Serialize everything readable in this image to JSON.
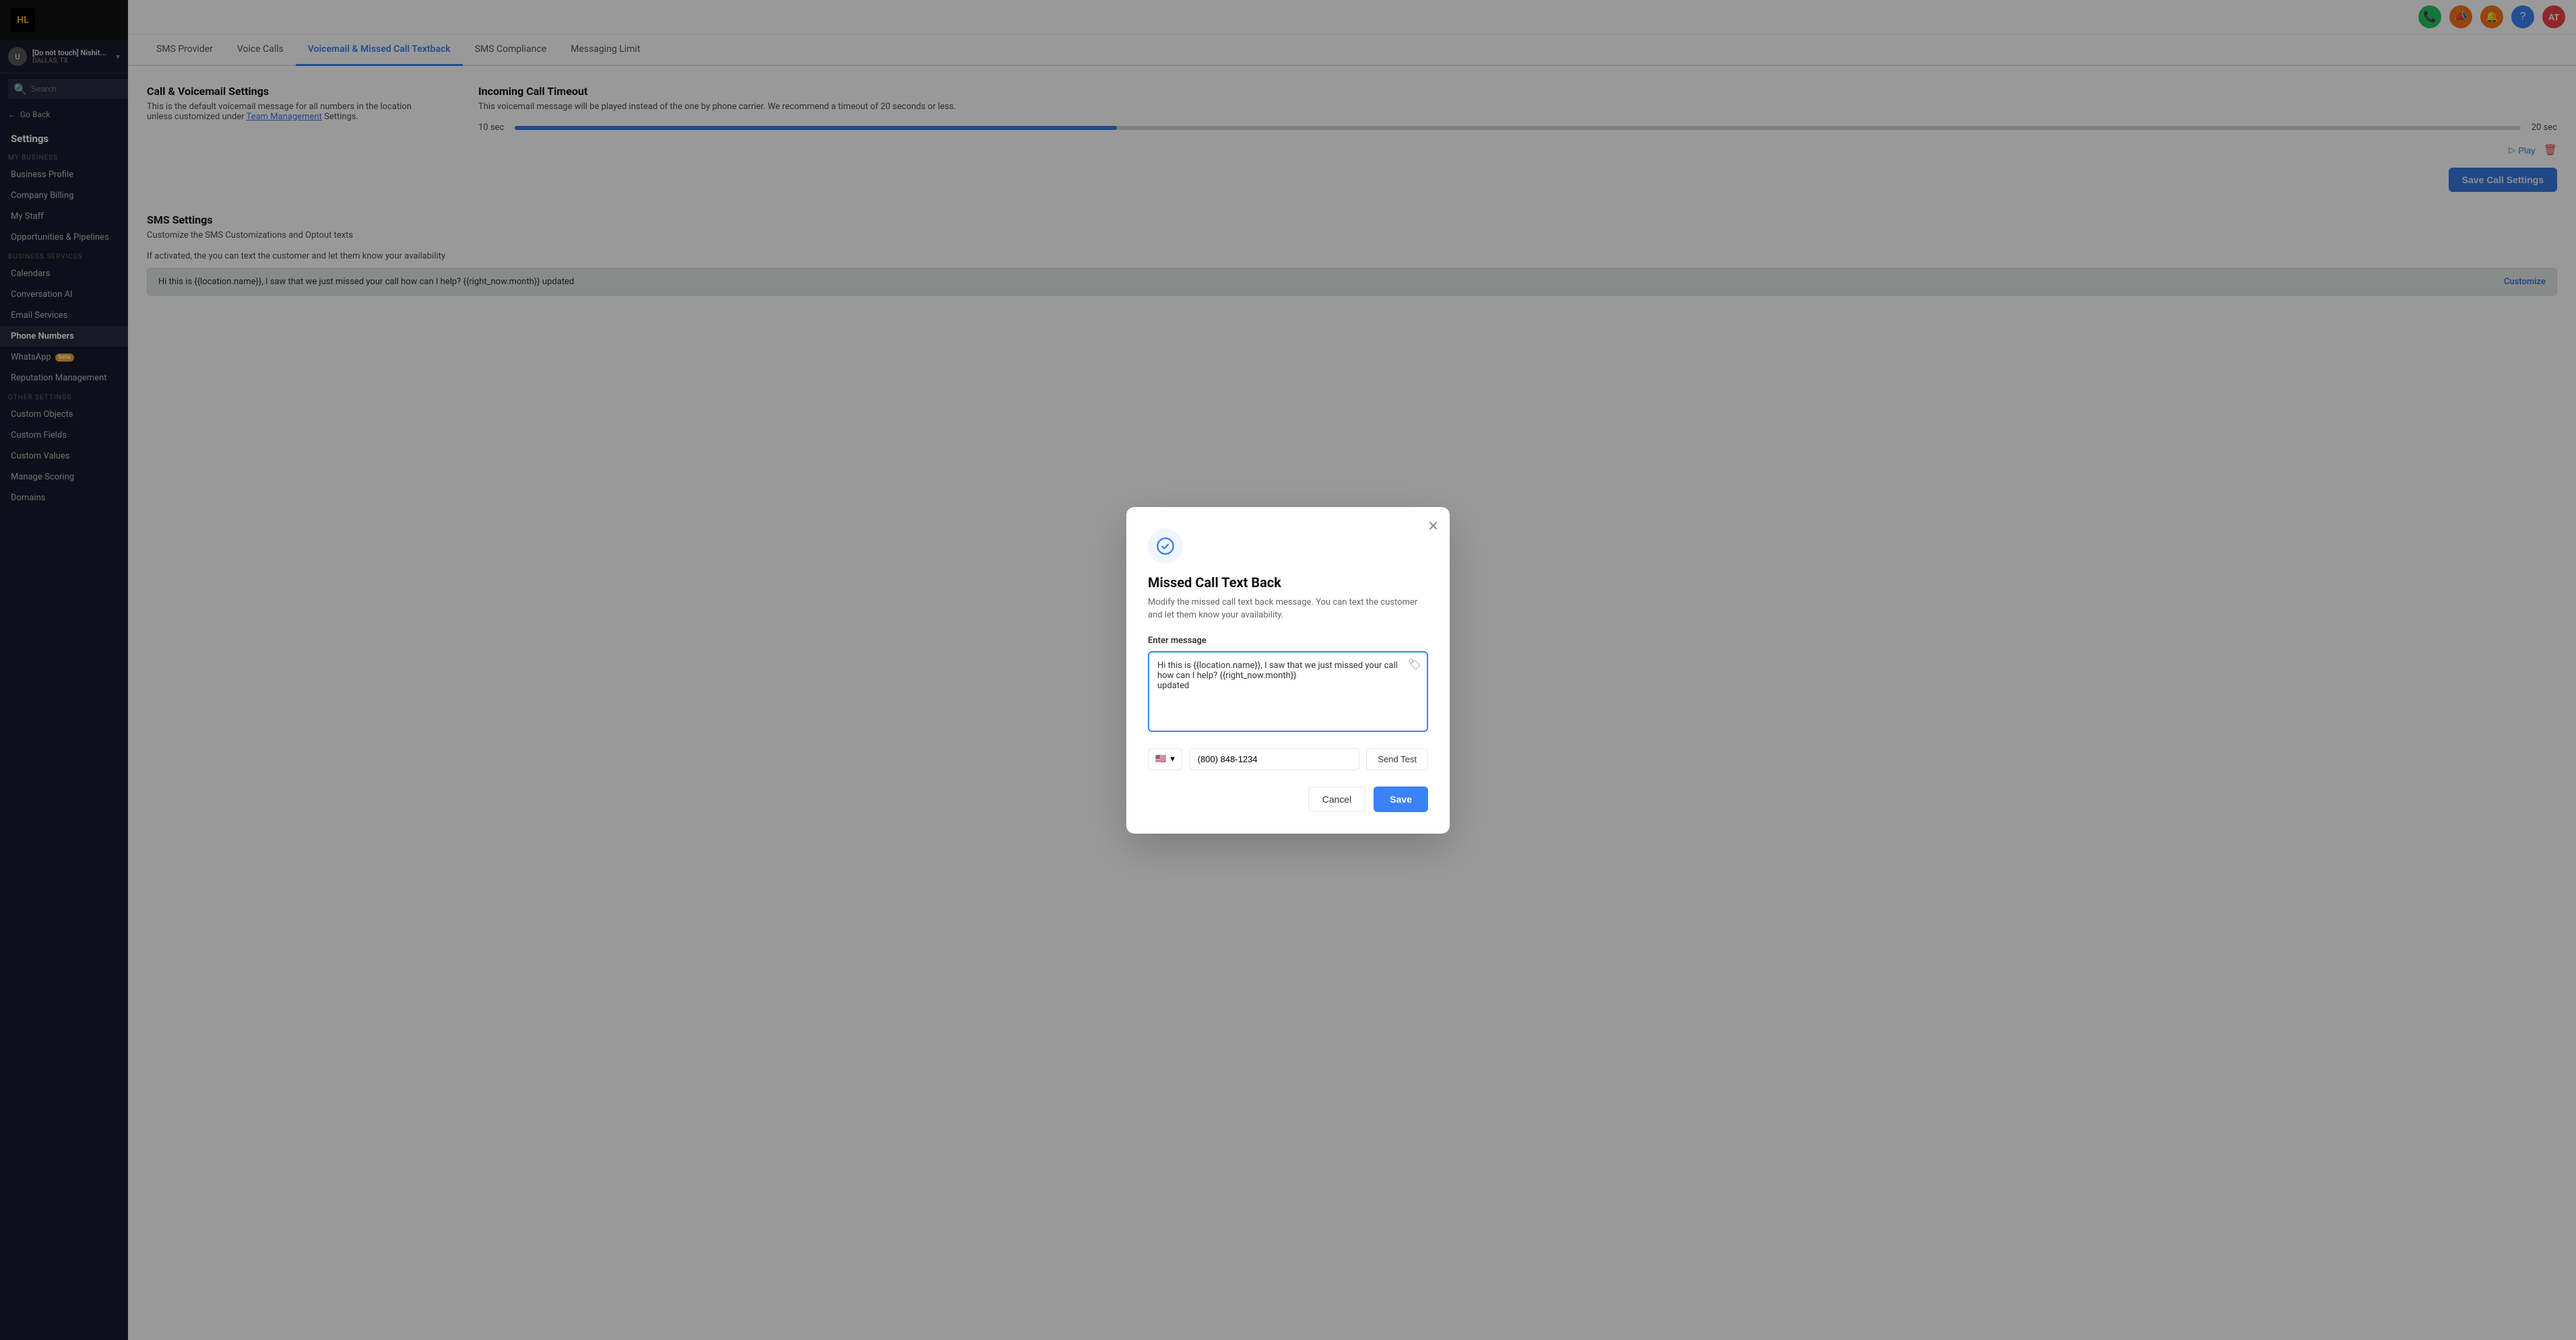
{
  "sidebar": {
    "logo_text": "HL",
    "account_name": "[Do not touch] Nishit...",
    "account_sub": "DALLAS, TX",
    "search_placeholder": "Search",
    "go_back_label": "Go Back",
    "settings_heading": "Settings",
    "section_my_business": "MY BUSINESS",
    "section_business_services": "BUSINESS SERVICES",
    "section_other_settings": "OTHER SETTINGS",
    "items_my_business": [
      {
        "id": "business-profile",
        "label": "Business Profile"
      },
      {
        "id": "company-billing",
        "label": "Company Billing"
      },
      {
        "id": "my-staff",
        "label": "My Staff"
      },
      {
        "id": "opportunities-pipelines",
        "label": "Opportunities & Pipelines"
      }
    ],
    "items_business_services": [
      {
        "id": "calendars",
        "label": "Calendars"
      },
      {
        "id": "conversation-ai",
        "label": "Conversation AI"
      },
      {
        "id": "email-services",
        "label": "Email Services"
      },
      {
        "id": "phone-numbers",
        "label": "Phone Numbers",
        "active": true
      },
      {
        "id": "whatsapp",
        "label": "WhatsApp",
        "badge": "beta"
      },
      {
        "id": "reputation-management",
        "label": "Reputation Management"
      }
    ],
    "items_other_settings": [
      {
        "id": "custom-objects",
        "label": "Custom Objects"
      },
      {
        "id": "custom-fields",
        "label": "Custom Fields"
      },
      {
        "id": "custom-values",
        "label": "Custom Values"
      },
      {
        "id": "manage-scoring",
        "label": "Manage Scoring"
      },
      {
        "id": "domains",
        "label": "Domains"
      }
    ]
  },
  "header": {
    "icons": [
      "phone",
      "megaphone",
      "bell",
      "question",
      "avatar"
    ],
    "avatar_text": "AT"
  },
  "tabs": [
    {
      "id": "sms-provider",
      "label": "SMS Provider"
    },
    {
      "id": "voice-calls",
      "label": "Voice Calls"
    },
    {
      "id": "voicemail-missed-call",
      "label": "Voicemail & Missed Call Textback",
      "active": true
    },
    {
      "id": "sms-compliance",
      "label": "SMS Compliance"
    },
    {
      "id": "messaging-limit",
      "label": "Messaging Limit"
    }
  ],
  "call_voicemail": {
    "title": "Call & Voicemail Settings",
    "desc": "This is the default voicemail message for all numbers in the location unless customized under",
    "link_text": "Team Management",
    "link_suffix": "Settings."
  },
  "incoming_call": {
    "title": "Incoming Call Timeout",
    "desc": "This voicemail message will be played instead of the one by phone carrier. We recommend a timeout of 20 seconds or less.",
    "slider_left": "10 sec",
    "slider_right": "20 sec",
    "play_label": "Play",
    "save_call_settings": "Save Call Settings"
  },
  "sms_settings": {
    "title": "SMS Settings",
    "desc": "Customize the SMS Customizations and Optout texts",
    "activation_text": "If activated, the you can text the customer and let them know your availability",
    "preview_text": "Hi this is {{location.name}}, I saw that we just missed your call how can I help? {{right_now.month}} updated",
    "customize_label": "Customize"
  },
  "modal": {
    "title": "Missed Call Text Back",
    "desc": "Modify the missed call text back message. You can text the customer and let them know your availability.",
    "enter_message_label": "Enter message",
    "message_text": "Hi this is {{location.name}}, I saw that we just missed your call\nhow can I help? {{right_now.month}}\nupdated",
    "phone_flag": "🇺🇸",
    "phone_number": "(800) 848-1234",
    "send_test_label": "Send Test",
    "cancel_label": "Cancel",
    "save_label": "Save",
    "close_aria": "Close dialog"
  }
}
